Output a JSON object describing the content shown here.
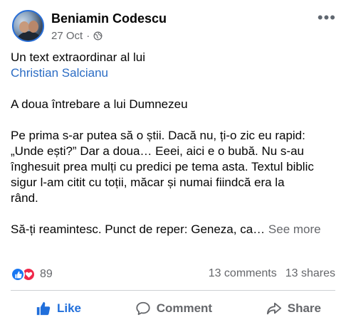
{
  "post": {
    "author": "Beniamin Codescu",
    "date": "27 Oct",
    "separator": "·",
    "more_label": "•••",
    "intro_line": "Un text extraordinar al lui",
    "mention": "Christian Salcianu",
    "heading_line": "A doua întrebare a lui Dumnezeu",
    "body_lines": [
      "Pe prima s-ar putea să o știi. Dacă nu, ți-o zic eu rapid:",
      "„Unde ești?” Dar a doua… Eeei, aici e o bubă. Nu s-au",
      "înghesuit prea mulți cu predici pe tema asta. Textul biblic",
      "sigur l-am citit cu toții, măcar și numai fiindcă era la",
      "rând."
    ],
    "last_line": "Să-ți reamintesc. Punct de reper: Geneza, ca…",
    "see_more": "See more"
  },
  "stats": {
    "reaction_count": "89",
    "comments": "13 comments",
    "shares": "13 shares"
  },
  "actions": {
    "like": "Like",
    "comment": "Comment",
    "share": "Share"
  },
  "colors": {
    "link": "#2b6cc4",
    "like_active": "#216fdb",
    "reaction_like": "#1877f2",
    "reaction_love": "#f0284a",
    "muted": "#65676b"
  },
  "icons": [
    "globe-icon",
    "more-icon",
    "like-reaction-icon",
    "love-reaction-icon",
    "thumbs-up-icon",
    "comment-icon",
    "share-icon"
  ]
}
